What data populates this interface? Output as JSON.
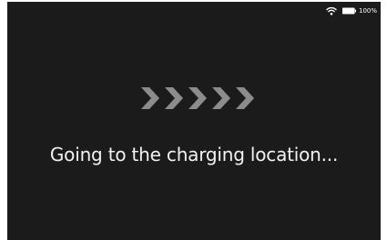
{
  "status_bar": {
    "wifi_icon": "wifi-icon",
    "battery_icon": "battery-icon",
    "battery_percent": "100%"
  },
  "progress_indicator": {
    "icon": "chevrons-right-icon",
    "chevron_count": 5,
    "color": "#8c8c8c"
  },
  "message": "Going to the charging location...",
  "colors": {
    "background": "#1b1b1b",
    "text": "#f2f2f2",
    "status": "#ffffff"
  }
}
